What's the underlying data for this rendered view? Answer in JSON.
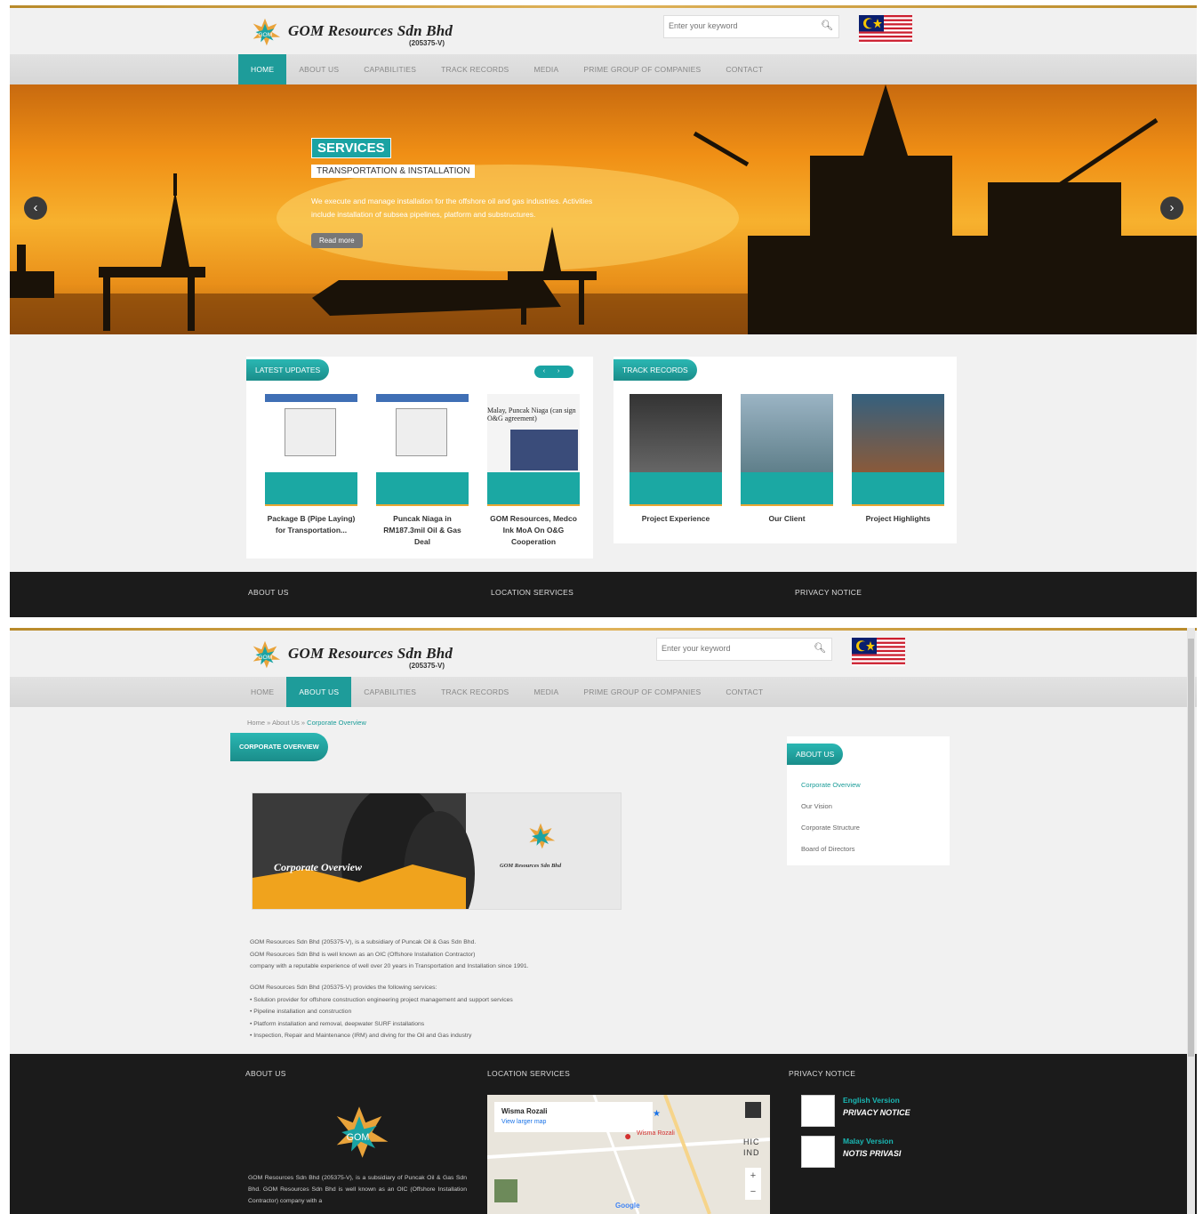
{
  "brand": {
    "name": "GOM Resources Sdn Bhd",
    "reg_no": "(205375-V)",
    "logo_text": "GOM"
  },
  "search": {
    "placeholder_home": "Enter your keyword",
    "placeholder_about": "Enter your keyword"
  },
  "nav": {
    "items": [
      "HOME",
      "ABOUT US",
      "CAPABILITIES",
      "TRACK RECORDS",
      "MEDIA",
      "PRIME GROUP OF COMPANIES",
      "CONTACT"
    ],
    "active_home": "HOME",
    "active_about": "ABOUT US"
  },
  "hero": {
    "tag": "SERVICES",
    "subtitle": "TRANSPORTATION & INSTALLATION",
    "description": "We execute and manage installation for the offshore oil and gas industries. Activities include installation of subsea pipelines, platform and substructures.",
    "button": "Read more",
    "prev": "‹",
    "next": "›"
  },
  "latest_updates": {
    "title": "LATEST UPDATES",
    "pager": "‹ ›",
    "cards": [
      {
        "caption": "Package B (Pipe Laying) for Transportation..."
      },
      {
        "caption": "Puncak Niaga in RM187.3mil Oil & Gas Deal"
      },
      {
        "caption": "GOM Resources, Medco Ink MoA On O&G Cooperation"
      }
    ],
    "newspaper_headline": "Malay, Puncak Niaga (can sign O&G agreement)"
  },
  "track_records": {
    "title": "TRACK RECORDS",
    "cards": [
      {
        "caption": "Project Experience"
      },
      {
        "caption": "Our Client"
      },
      {
        "caption": "Project Highlights"
      }
    ]
  },
  "footer": {
    "about": "ABOUT US",
    "location": "LOCATION SERVICES",
    "privacy": "PRIVACY NOTICE",
    "about_text": "GOM Resources Sdn Bhd (205375-V), is a subsidiary of Puncak Oil & Gas Sdn Bhd. GOM Resources Sdn Bhd is well known as an OIC (Offshore Installation Contractor) company with a",
    "map": {
      "place": "Wisma Rozali",
      "link": "View larger map",
      "brand": "Google",
      "pin": "Wisma Rozali",
      "label_hic": "HIC",
      "label_ind": "IND"
    },
    "privacy_links": [
      {
        "lang": "English Version",
        "title": "PRIVACY NOTICE"
      },
      {
        "lang": "Malay Version",
        "title": "NOTIS PRIVASI"
      }
    ]
  },
  "about_page": {
    "breadcrumb": {
      "home": "Home",
      "about": "About Us",
      "current": "Corporate Overview",
      "sep": "»"
    },
    "section_title": "CORPORATE OVERVIEW",
    "banner_title": "Corporate Overview",
    "banner_brand": "GOM Resources Sdn Bhd",
    "sidebar_title": "ABOUT US",
    "sidebar_items": [
      "Corporate Overview",
      "Our Vision",
      "Corporate Structure",
      "Board of Directors"
    ],
    "paragraph1": [
      "GOM Resources Sdn Bhd (205375-V), is a subsidiary of Puncak Oil & Gas Sdn Bhd.",
      "GOM Resources Sdn Bhd is well known as an OIC (Offshore Installation Contractor)",
      "company with a reputable experience of well over 20 years in Transportation and Installation since 1991."
    ],
    "paragraph2": [
      "GOM Resources Sdn Bhd (205375-V) provides the following services:",
      "• Solution provider for offshore construction engineering project management and support services",
      "• Pipeline installation and construction",
      "• Platform installation and removal, deepwater SURF installations",
      "• Inspection, Repair and Maintenance (IRM) and diving for the Oil and Gas industry"
    ]
  },
  "colors": {
    "teal": "#1aa3a3",
    "gold": "#e8a734",
    "footer_bg": "#1b1b1b",
    "hero_orange": "#f08f15"
  }
}
